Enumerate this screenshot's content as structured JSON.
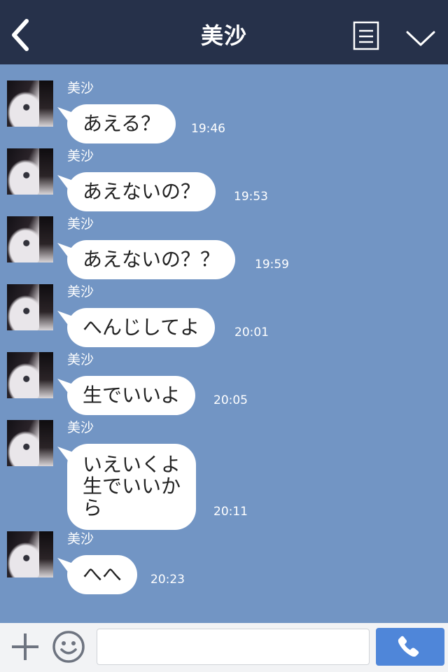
{
  "header": {
    "title": "美沙",
    "back_icon": "chevron-left-icon",
    "menu_icon": "list-icon",
    "collapse_icon": "chevron-down-icon"
  },
  "messages": [
    {
      "sender": "美沙",
      "text": "あえる？",
      "time": "19:46"
    },
    {
      "sender": "美沙",
      "text": "あえないの？",
      "time": "19:53"
    },
    {
      "sender": "美沙",
      "text": "あえないの？？",
      "time": "19:59"
    },
    {
      "sender": "美沙",
      "text": "へんじしてよ",
      "time": "20:01"
    },
    {
      "sender": "美沙",
      "text": "生でいいよ",
      "time": "20:05"
    },
    {
      "sender": "美沙",
      "text": "いえいくよ\n生でいいか\nら",
      "time": "20:11"
    },
    {
      "sender": "美沙",
      "text": "へへ",
      "time": "20:23"
    }
  ],
  "footer": {
    "plus_icon": "plus-icon",
    "emoji_icon": "smiley-icon",
    "input_value": "",
    "call_icon": "phone-icon"
  },
  "colors": {
    "header_bg": "#26314a",
    "chat_bg": "#7295c4",
    "bubble_bg": "#ffffff",
    "footer_bg": "#f2f3f5",
    "call_button": "#4f86d9"
  }
}
